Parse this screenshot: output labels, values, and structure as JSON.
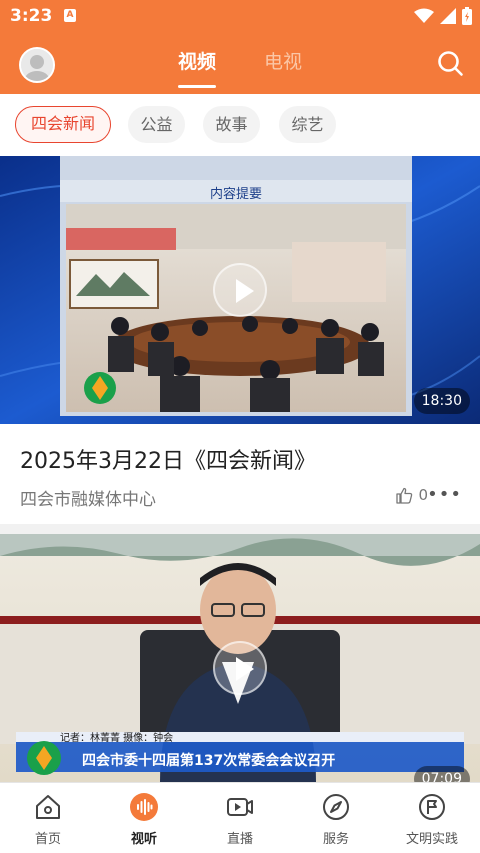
{
  "status_bar": {
    "time": "3:23",
    "badge": "A"
  },
  "header": {
    "tabs": [
      {
        "label": "视频",
        "active": true
      },
      {
        "label": "电视",
        "active": false
      }
    ]
  },
  "categories": [
    {
      "label": "四会新闻",
      "active": true
    },
    {
      "label": "公益",
      "active": false
    },
    {
      "label": "故事",
      "active": false
    },
    {
      "label": "综艺",
      "active": false
    }
  ],
  "videos": [
    {
      "title": "2025年3月22日《四会新闻》",
      "source": "四会市融媒体中心",
      "likes": "0",
      "duration": "18:30",
      "thumb_caption": "内容提要"
    },
    {
      "duration": "07:09",
      "reporter": "记者：林菁菁  摄像：钟会",
      "headline": "四会市委十四届第137次常委会会议召开"
    }
  ],
  "bottom_nav": [
    {
      "label": "首页",
      "icon": "home-icon",
      "active": false
    },
    {
      "label": "视听",
      "icon": "audio-video-icon",
      "active": true
    },
    {
      "label": "直播",
      "icon": "live-icon",
      "active": false
    },
    {
      "label": "服务",
      "icon": "compass-icon",
      "active": false
    },
    {
      "label": "文明实践",
      "icon": "flag-icon",
      "active": false
    }
  ],
  "colors": {
    "brand": "#f47a3a",
    "accent": "#e8452f"
  }
}
